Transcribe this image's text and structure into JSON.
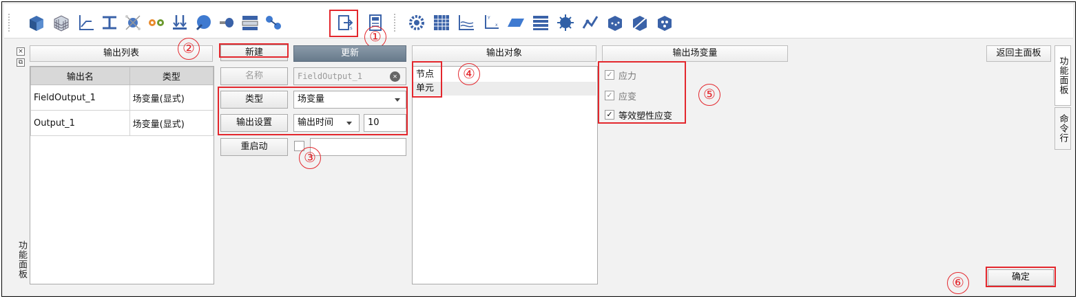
{
  "toolbar": {
    "icons": [
      "part-cube-icon",
      "mesh-grid-icon",
      "curve-axis-icon",
      "beam-section-icon",
      "assembly-icon",
      "gear-link-icon",
      "load-arrows-icon",
      "sphere-icon",
      "shaft-icon",
      "layer-icon",
      "connector-icon",
      "output-export-icon",
      "calculator-icon",
      "settings-gear-icon",
      "table-grid-icon",
      "xy-plot-icon",
      "coordinate-axis-icon",
      "plane-icon",
      "list-icon",
      "virus-icon",
      "rig-icon",
      "cube-dots-icon",
      "cube-slash-icon",
      "cube-face-icon"
    ]
  },
  "callouts": [
    "①",
    "②",
    "③",
    "④",
    "⑤",
    "⑥"
  ],
  "left_panel": {
    "header": "输出列表",
    "vertical_label": "功能面板",
    "columns": [
      "输出名",
      "类型"
    ],
    "rows": [
      {
        "name": "FieldOutput_1",
        "type": "场变量(显式)"
      },
      {
        "name": "Output_1",
        "type": "场变量(显式)"
      }
    ]
  },
  "editor": {
    "new_label": "新建",
    "update_label": "更新",
    "name_label": "名称",
    "name_value": "FieldOutput_1",
    "type_label": "类型",
    "type_value": "场变量",
    "output_settings_label": "输出设置",
    "output_mode_value": "输出时间",
    "output_number": "10",
    "restart_label": "重启动"
  },
  "objects": {
    "header": "输出对象",
    "items": [
      "节点",
      "单元"
    ]
  },
  "variables": {
    "header": "输出场变量",
    "items": [
      {
        "label": "应力",
        "checked": true,
        "enabled": false
      },
      {
        "label": "应变",
        "checked": true,
        "enabled": false
      },
      {
        "label": "等效塑性应变",
        "checked": true,
        "enabled": true
      }
    ]
  },
  "right": {
    "back_label": "返回主面板",
    "tabs": [
      "功能面板",
      "命令行"
    ],
    "confirm_label": "确定"
  }
}
